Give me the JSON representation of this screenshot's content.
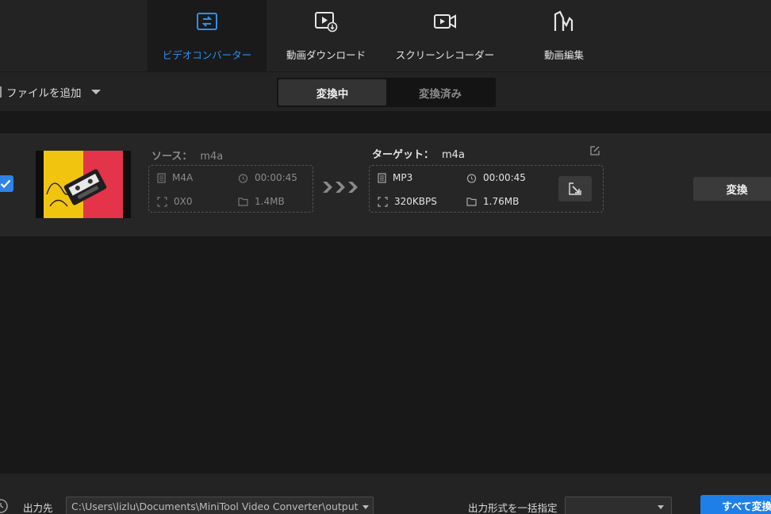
{
  "nav": {
    "tabs": [
      {
        "label": "ビデオコンバーター",
        "icon": "convert-icon",
        "active": true
      },
      {
        "label": "動画ダウンロード",
        "icon": "video-download-icon",
        "active": false
      },
      {
        "label": "スクリーンレコーダー",
        "icon": "screen-record-icon",
        "active": false
      },
      {
        "label": "動画編集",
        "icon": "movie-edit-icon",
        "active": false
      }
    ]
  },
  "toolbar": {
    "add_file_label": "ファイルを追加",
    "segments": [
      "変換中",
      "変換済み"
    ],
    "active_segment": 0
  },
  "file": {
    "checked": true,
    "source": {
      "label": "ソース：",
      "format": "m4a",
      "container": "M4A",
      "duration": "00:00:45",
      "resolution": "0X0",
      "size": "1.4MB"
    },
    "target": {
      "label": "ターゲット：",
      "format": "m4a",
      "container": "MP3",
      "duration": "00:00:45",
      "bitrate": "320KBPS",
      "size": "1.76MB"
    },
    "convert_label": "変換"
  },
  "bottom": {
    "output_label": "出力先",
    "output_path": "C:\\Users\\lizlu\\Documents\\MiniTool Video Converter\\output",
    "batch_label": "出力形式を一括指定",
    "batch_value": "",
    "convert_all_label": "すべて変換"
  },
  "colors": {
    "accent": "#2f8ff0",
    "primary_button": "#1f7fe8",
    "background": "#181818",
    "panel": "#232323",
    "row": "#262626"
  }
}
